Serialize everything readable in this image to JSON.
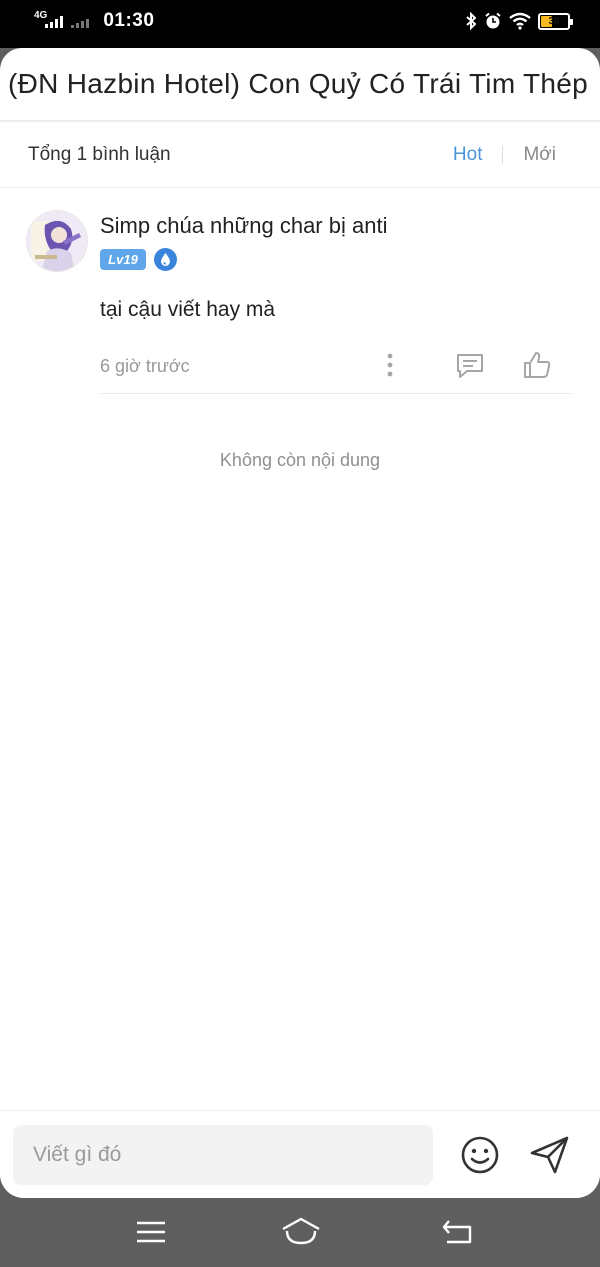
{
  "status_bar": {
    "network": "4G",
    "time": "01:30",
    "battery_level": "38"
  },
  "header": {
    "title": "(ĐN Hazbin Hotel) Con Quỷ Có Trái Tim Thép"
  },
  "summary": {
    "total_label": "Tổng 1 bình luận",
    "sort_hot": "Hot",
    "sort_new": "Mới"
  },
  "comments": [
    {
      "user_name": "Simp chúa những char bị anti",
      "level": "Lv19",
      "text": "tại cậu viết hay mà",
      "time": "6 giờ trước"
    }
  ],
  "end_of_list": "Không còn nội dung",
  "composer": {
    "placeholder": "Viết gì đó"
  },
  "colors": {
    "accent": "#4b95d8",
    "level_badge": "#5fa6ea",
    "battery": "#f5b820"
  }
}
